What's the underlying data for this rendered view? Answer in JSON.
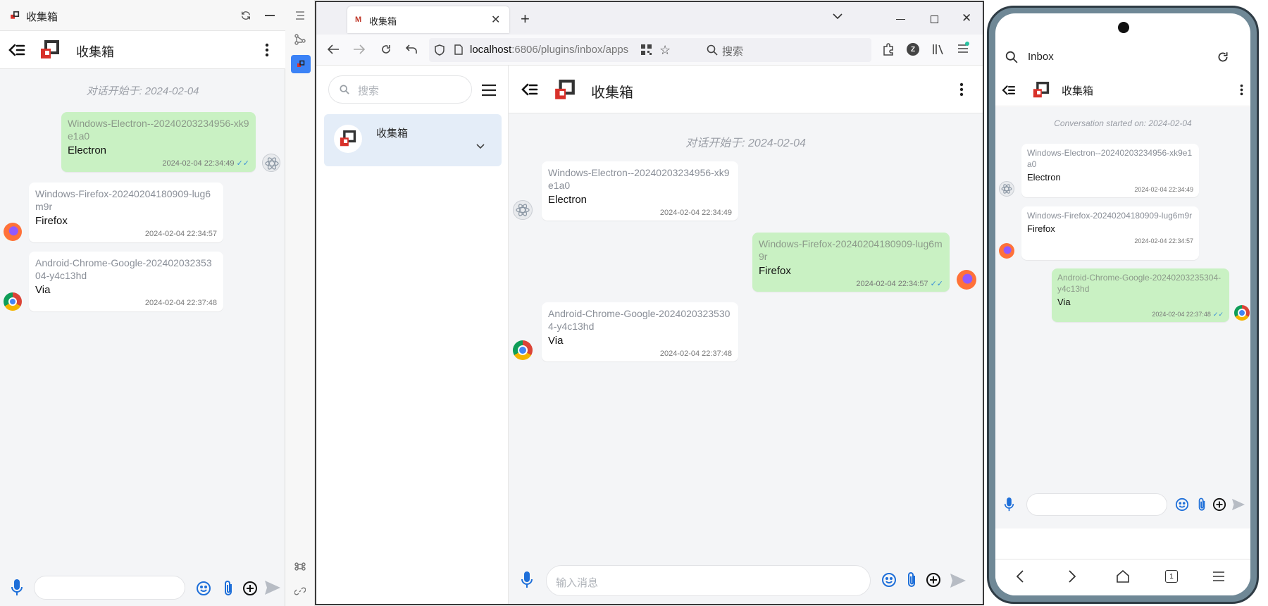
{
  "left": {
    "window_title": "收集箱",
    "header_title": "收集箱",
    "start": "对话开始于: 2024-02-04",
    "messages": [
      {
        "source": "Windows-Electron--20240203234956-xk9e1a0",
        "text": "Electron",
        "time": "2024-02-04 22:34:49",
        "read": true
      },
      {
        "source": "Windows-Firefox-20240204180909-lug6m9r",
        "text": "Firefox",
        "time": "2024-02-04 22:34:57",
        "read": false
      },
      {
        "source": "Android-Chrome-Google-20240203235304-y4c13hd",
        "text": "Via",
        "time": "2024-02-04 22:37:48",
        "read": false
      }
    ]
  },
  "browser": {
    "tab_title": "收集箱",
    "url_host": "localhost",
    "url_rest": ":6806/plugins/inbox/apps",
    "search_placeholder": "搜索",
    "sidebar_search_placeholder": "搜索",
    "sidebar_item": "收集箱",
    "header_title": "收集箱",
    "start": "对话开始于: 2024-02-04",
    "input_placeholder": "输入消息",
    "messages": [
      {
        "source": "Windows-Electron--20240203234956-xk9e1a0",
        "text": "Electron",
        "time": "2024-02-04 22:34:49"
      },
      {
        "source": "Windows-Firefox-20240204180909-lug6m9r",
        "text": "Firefox",
        "time": "2024-02-04 22:34:57"
      },
      {
        "source": "Android-Chrome-Google-20240203235304-y4c13hd",
        "text": "Via",
        "time": "2024-02-04 22:37:48"
      }
    ]
  },
  "phone": {
    "search_text": "Inbox",
    "header_title": "收集箱",
    "start": "Conversation started on: 2024-02-04",
    "messages": [
      {
        "source": "Windows-Electron--20240203234956-xk9e1a0",
        "text": "Electron",
        "time": "2024-02-04 22:34:49"
      },
      {
        "source": "Windows-Firefox-20240204180909-lug6m9r",
        "text": "Firefox",
        "time": "2024-02-04 22:34:57"
      },
      {
        "source": "Android-Chrome-Google-20240203235304-y4c13hd",
        "text": "Via",
        "time": "2024-02-04 22:37:48"
      }
    ],
    "tab_count": "1"
  },
  "colors": {
    "accent": "#1e6fd9",
    "out_bubble": "#c9f1c3",
    "chat_bg": "#f4f5f7",
    "logo_red": "#d8312a"
  }
}
